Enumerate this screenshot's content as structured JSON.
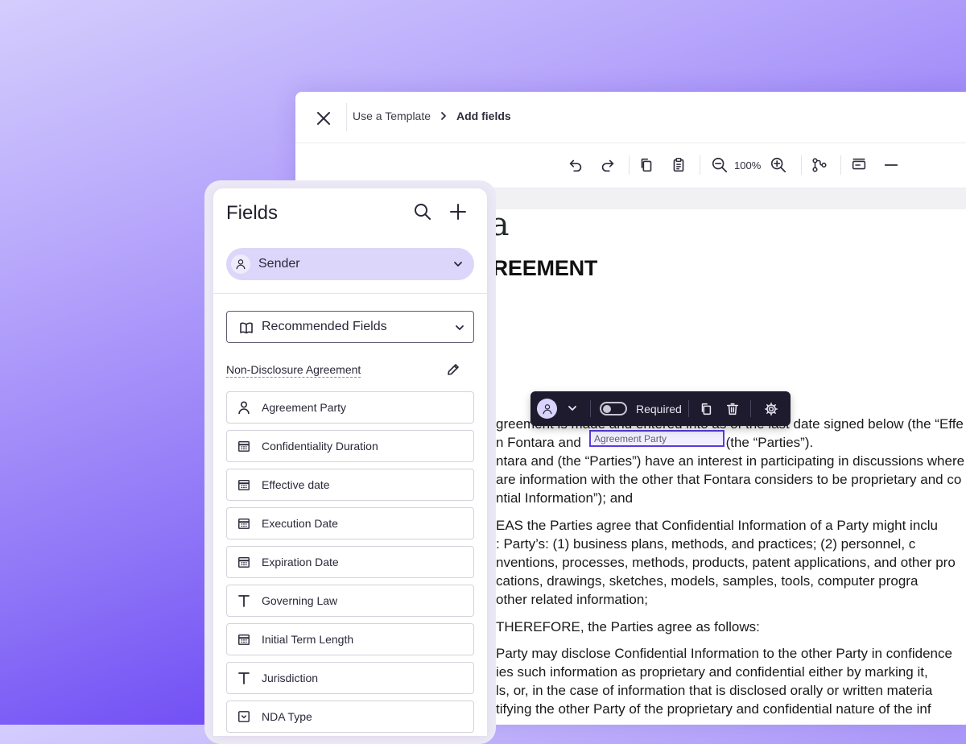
{
  "breadcrumb": {
    "parent": "Use a Template",
    "current": "Add fields"
  },
  "toolbar": {
    "zoom": "100%"
  },
  "document": {
    "logo_text": "fontara",
    "title": "NON-DISCLOSURE AGREEMENT",
    "placed_field": "Agreement Party",
    "paragraphs": [
      [
        "greement is made and entered into as of the last date signed below (the “Effe",
        "n Fontara and ",
        "ntara and (the “Parties”) have an interest in participating in discussions where",
        "are information with the other that Fontara considers to be proprietary and co",
        "ntial Information”); and"
      ],
      [
        "EAS the Parties agree that Confidential Information of a Party might inclu",
        ": Party’s: (1) business plans, methods, and practices; (2) personnel, c",
        "nventions, processes, methods, products, patent applications, and other pro",
        "cations, drawings, sketches, models, samples, tools, computer progra",
        "other related information;"
      ],
      [
        "THEREFORE, the Parties agree as follows:"
      ],
      [
        "Party may disclose Confidential Information to the other Party in confidence",
        "ies such information as proprietary and confidential either by marking it,",
        "ls, or, in the case of information that is disclosed orally or written materia",
        "tifying the other Party of the proprietary and confidential nature of the inf"
      ]
    ],
    "parties_suffix": "(the “Parties”)."
  },
  "floating_toolbar": {
    "required_label": "Required",
    "required_on": false
  },
  "panel": {
    "title": "Fields",
    "recipient": "Sender",
    "category": "Recommended Fields",
    "group_title": "Non-Disclosure Agreement",
    "fields": [
      {
        "label": "Agreement Party",
        "icon": "person-icon"
      },
      {
        "label": "Confidentiality Duration",
        "icon": "calendar-icon"
      },
      {
        "label": "Effective date",
        "icon": "calendar-icon"
      },
      {
        "label": "Execution Date",
        "icon": "calendar-icon"
      },
      {
        "label": "Expiration Date",
        "icon": "calendar-icon"
      },
      {
        "label": "Governing Law",
        "icon": "text-icon"
      },
      {
        "label": "Initial Term Length",
        "icon": "calendar-icon"
      },
      {
        "label": "Jurisdiction",
        "icon": "text-icon"
      },
      {
        "label": "NDA Type",
        "icon": "dropdown-icon"
      }
    ]
  },
  "colors": {
    "accent": "#5a3be0",
    "sender_bg": "#dcd6fb",
    "logo_green": "#4fd39a"
  }
}
